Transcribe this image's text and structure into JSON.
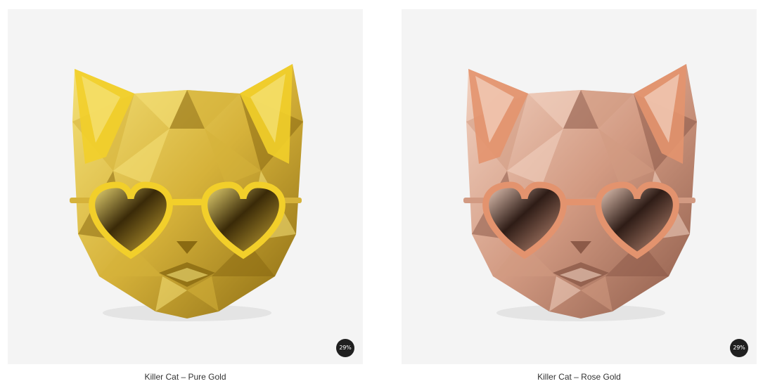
{
  "products": [
    {
      "title": "Killer Cat – Pure Gold",
      "discount_badge": "29%",
      "image_icon": "gold-cat-air-freshener-icon",
      "colors": {
        "light": "#f5e27a",
        "mid": "#d6b23a",
        "dark": "#8a6a12",
        "shadow": "#3a2a08",
        "ear": "#f2cf2a"
      }
    },
    {
      "title": "Killer Cat – Rose Gold",
      "discount_badge": "29%",
      "image_icon": "rose-gold-cat-air-freshener-icon",
      "colors": {
        "light": "#f3d3c2",
        "mid": "#d29a82",
        "dark": "#8c5a48",
        "shadow": "#2e1c16",
        "ear": "#e3936e"
      }
    }
  ]
}
